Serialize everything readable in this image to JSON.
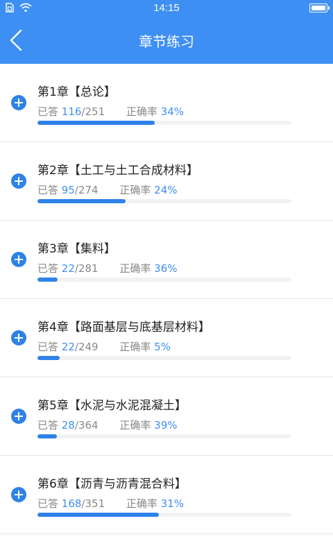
{
  "status_bar": {
    "time": "14:15"
  },
  "nav": {
    "title": "章节练习"
  },
  "labels": {
    "answered": "已答",
    "slash": "/",
    "accuracy": "正确率"
  },
  "colors": {
    "accent": "#3d8ff3",
    "bar_fill": "#2f82e8"
  },
  "chapters": [
    {
      "title": "第1章【总论】",
      "answered": "116",
      "total": "251",
      "accuracy": "34%",
      "progress": 0.462
    },
    {
      "title": "第2章【土工与土工合成材料】",
      "answered": "95",
      "total": "274",
      "accuracy": "24%",
      "progress": 0.347
    },
    {
      "title": "第3章【集料】",
      "answered": "22",
      "total": "281",
      "accuracy": "36%",
      "progress": 0.078
    },
    {
      "title": "第4章【路面基层与底基层材料】",
      "answered": "22",
      "total": "249",
      "accuracy": "5%",
      "progress": 0.088
    },
    {
      "title": "第5章【水泥与水泥混凝土】",
      "answered": "28",
      "total": "364",
      "accuracy": "39%",
      "progress": 0.077
    },
    {
      "title": "第6章【沥青与沥青混合料】",
      "answered": "168",
      "total": "351",
      "accuracy": "31%",
      "progress": 0.479
    }
  ]
}
